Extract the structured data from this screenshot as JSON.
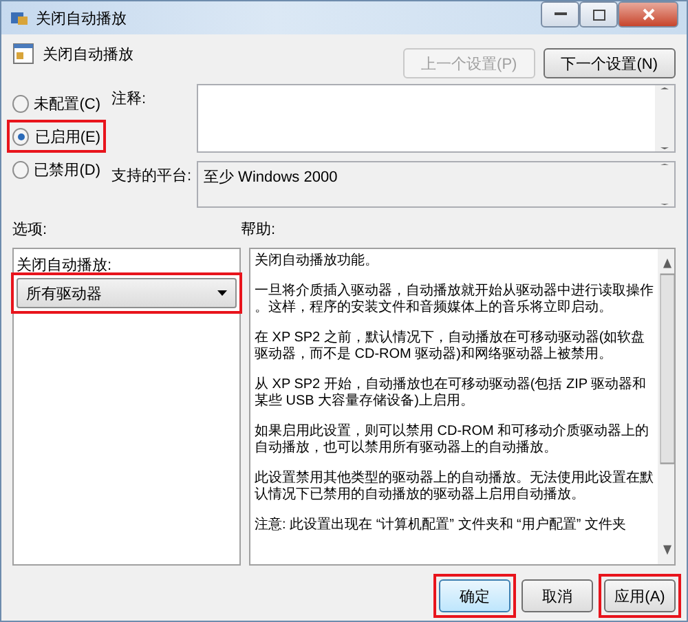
{
  "window": {
    "title": "关闭自动播放"
  },
  "policy": {
    "name": "关闭自动播放"
  },
  "nav_buttons": [
    {
      "label": "上一个设置(P)",
      "disabled": true
    },
    {
      "label": "下一个设置(N)",
      "disabled": false
    }
  ],
  "state_options": [
    {
      "label": "未配置(C)",
      "selected": false,
      "highlighted": false
    },
    {
      "label": "已启用(E)",
      "selected": true,
      "highlighted": true
    },
    {
      "label": "已禁用(D)",
      "selected": false,
      "highlighted": false
    }
  ],
  "comment": {
    "label": "注释:"
  },
  "platform": {
    "label": "支持的平台:",
    "value": "至少 Windows 2000"
  },
  "options": {
    "label": "选项:",
    "field_label": "关闭自动播放:",
    "dropdown": {
      "value": "所有驱动器",
      "highlighted": true
    }
  },
  "help": {
    "label": "帮助:",
    "paragraphs": [
      [
        "关闭自动播放功能。"
      ],
      [
        "一旦将介质插入驱动器，自动播放就开始从驱动器中进行读取操作",
        "。这样，程序的安装文件和音频媒体上的音乐将立即启动。"
      ],
      [
        "在 XP SP2 之前，默认情况下，自动播放在可移动驱动器(如软盘",
        "驱动器，而不是 CD-ROM 驱动器)和网络驱动器上被禁用。"
      ],
      [
        "从 XP SP2 开始，自动播放也在可移动驱动器(包括 ZIP 驱动器和",
        "某些 USB 大容量存储设备)上启用。"
      ],
      [
        "如果启用此设置，则可以禁用 CD-ROM 和可移动介质驱动器上的",
        "自动播放，也可以禁用所有驱动器上的自动播放。"
      ],
      [
        "此设置禁用其他类型的驱动器上的自动播放。无法使用此设置在默",
        "认情况下已禁用的自动播放的驱动器上启用自动播放。"
      ],
      [
        "注意: 此设置出现在 “计算机配置” 文件夹和 “用户配置” 文件夹"
      ]
    ]
  },
  "buttons": [
    {
      "label": "确定",
      "highlighted": true,
      "default": true
    },
    {
      "label": "取消",
      "highlighted": false,
      "default": false
    },
    {
      "label": "应用(A)",
      "highlighted": true,
      "default": false
    }
  ]
}
